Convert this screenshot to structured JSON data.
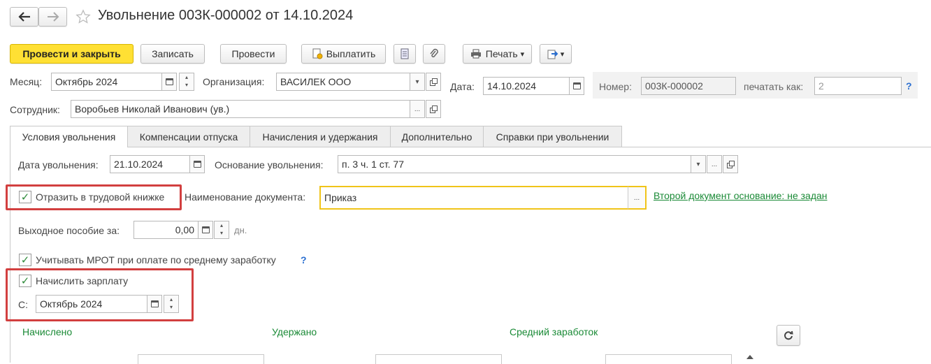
{
  "window": {
    "title": "Увольнение 003К-000002 от 14.10.2024",
    "back_icon": "arrow-left-icon",
    "forward_icon": "arrow-right-icon",
    "star_icon": "star-icon"
  },
  "toolbar": {
    "post_close": "Провести и закрыть",
    "save": "Записать",
    "post": "Провести",
    "pay": "Выплатить",
    "print": "Печать",
    "print_arrow": "▾",
    "more_arrow": "▾"
  },
  "header": {
    "month_label": "Месяц:",
    "month_value": "Октябрь 2024",
    "org_label": "Организация:",
    "org_value": "ВАСИЛЕК ООО",
    "date_label": "Дата:",
    "date_value": "14.10.2024",
    "number_label": "Номер:",
    "number_value": "003К-000002",
    "print_as_label": "печатать как:",
    "print_as_value": "2",
    "help": "?",
    "employee_label": "Сотрудник:",
    "employee_value": "Воробьев Николай Иванович (ув.)"
  },
  "tabs": [
    {
      "label": "Условия увольнения",
      "active": true
    },
    {
      "label": "Компенсации отпуска",
      "active": false
    },
    {
      "label": "Начисления и удержания",
      "active": false
    },
    {
      "label": "Дополнительно",
      "active": false
    },
    {
      "label": "Справки при увольнении",
      "active": false
    }
  ],
  "form": {
    "dismissal_date_label": "Дата увольнения:",
    "dismissal_date_value": "21.10.2024",
    "basis_label": "Основание увольнения:",
    "basis_value": "п. 3 ч. 1 ст. 77",
    "reflect_label": "Отразить в трудовой книжке",
    "reflect_checked": true,
    "doc_name_label": "Наименование документа:",
    "doc_name_value": "Приказ",
    "second_doc_link": "Второй документ основание: не задан",
    "severance_label": "Выходное пособие за:",
    "severance_value": "0,00",
    "severance_unit": "дн.",
    "mrot_label": "Учитывать МРОТ при оплате по среднему заработку",
    "mrot_checked": true,
    "mrot_help": "?",
    "accrue_label": "Начислить зарплату",
    "accrue_checked": true,
    "from_label": "С:",
    "from_value": "Октябрь 2024"
  },
  "summary": {
    "accrued": "Начислено",
    "withheld": "Удержано",
    "avg_earnings": "Средний заработок"
  },
  "colors": {
    "accent_yellow": "#ffe034",
    "green": "#1a8a36",
    "highlight_red": "#d23f3f"
  },
  "glyphs": {
    "ellipsis": "...",
    "dropdown": "▾",
    "check": "✓",
    "refresh": "⟳"
  }
}
